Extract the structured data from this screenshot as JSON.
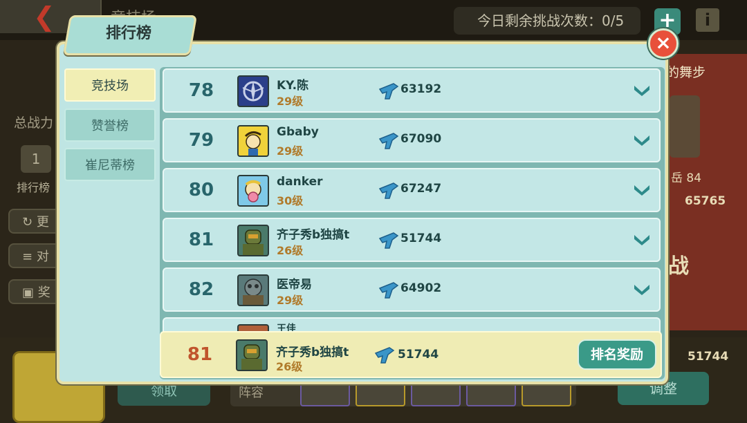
{
  "background": {
    "title": "竞技场",
    "challenges_text": "今日剩余挑战次数：0/5",
    "plus_label": "+",
    "info_label": "i",
    "total_power_label": "总战力",
    "rank_icon_number": "1",
    "rank_label": "排行榜",
    "left_buttons": [
      {
        "label": "更",
        "icon": "refresh-icon"
      },
      {
        "label": "对",
        "icon": "list-icon"
      },
      {
        "label": "奖",
        "icon": "gift-icon"
      }
    ],
    "right_panel_title": "的舞步",
    "right_level": "岳 84",
    "right_power": "65765",
    "right_fight": "战",
    "collect_button": "领取",
    "lineup_label": "阵容",
    "adjust_button": "调整",
    "bottom_power": "51744"
  },
  "dialog": {
    "title": "排行榜",
    "close_label": "×",
    "side_tabs": [
      {
        "label": "竞技场",
        "active": true
      },
      {
        "label": "赞誉榜",
        "active": false
      },
      {
        "label": "崔尼蒂榜",
        "active": false
      }
    ],
    "rows": [
      {
        "rank": "78",
        "name": "KY.陈",
        "level": "29级",
        "power": "63192",
        "avatar": "brotherhood-emblem"
      },
      {
        "rank": "79",
        "name": "Gbaby",
        "level": "29级",
        "power": "67090",
        "avatar": "vault-boy-salute"
      },
      {
        "rank": "80",
        "name": "danker",
        "level": "30级",
        "power": "67247",
        "avatar": "vault-boy-bubblegum"
      },
      {
        "rank": "81",
        "name": "齐子秀b独搞t",
        "level": "26级",
        "power": "51744",
        "avatar": "power-armor"
      },
      {
        "rank": "82",
        "name": "医帝易",
        "level": "29级",
        "power": "64902",
        "avatar": "gas-mask-armor"
      },
      {
        "rank": "",
        "name": "王佳",
        "level": "",
        "power": "",
        "avatar": "partial"
      }
    ],
    "my_row": {
      "rank": "81",
      "name": "齐子秀b独搞t",
      "level": "26级",
      "power": "51744",
      "avatar": "power-armor"
    },
    "reward_button": "排名奖励",
    "colors": {
      "panel": "#bfe5e3",
      "row": "#c3e7e6",
      "active_tab": "#f1eeb4",
      "rank_text": "#28656b",
      "my_rank_text": "#c0542c",
      "level_text": "#b07a2a"
    }
  }
}
